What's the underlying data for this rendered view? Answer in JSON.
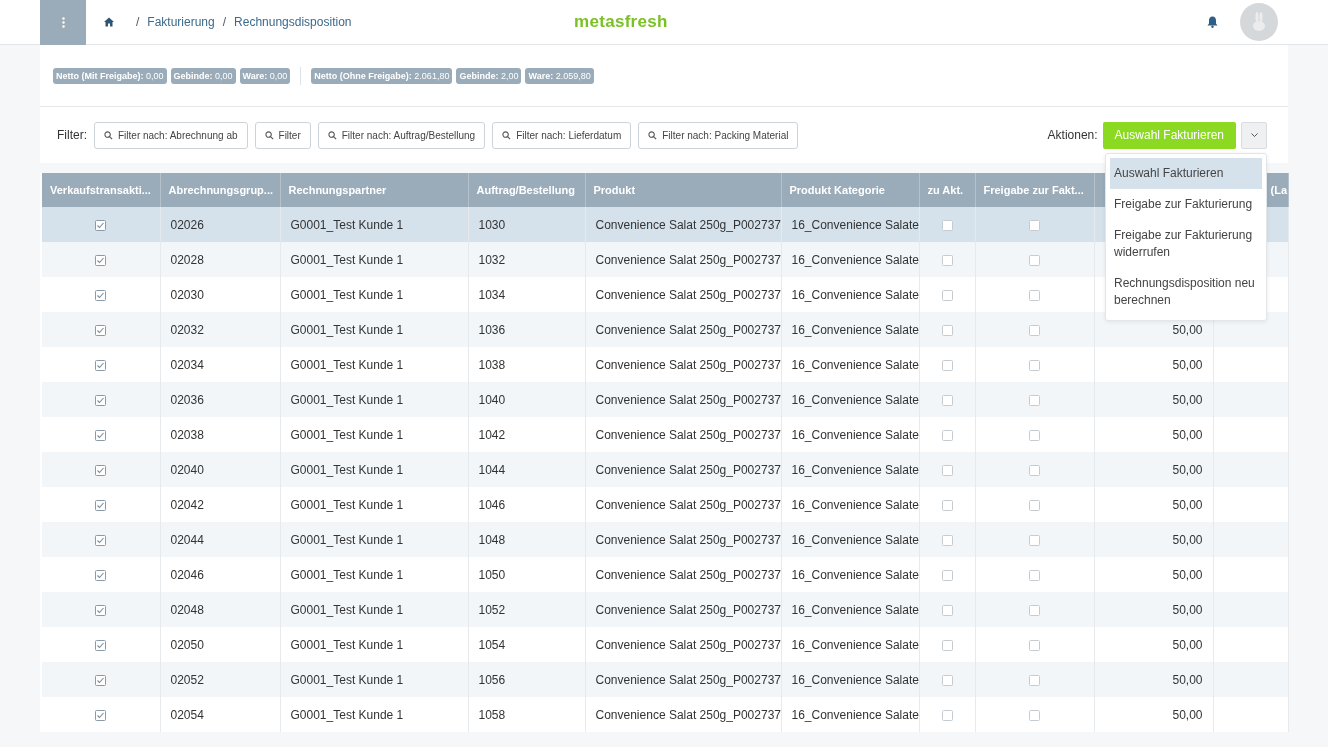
{
  "header": {
    "breadcrumb": [
      {
        "separator": "/",
        "label": "Fakturierung"
      },
      {
        "separator": "/",
        "label": "Rechnungsdisposition"
      }
    ],
    "logo": "metasfresh"
  },
  "summary": {
    "groups": [
      [
        {
          "label": "Netto (Mit Freigabe):",
          "value": "0,00"
        },
        {
          "label": "Gebinde:",
          "value": "0,00"
        },
        {
          "label": "Ware:",
          "value": "0,00"
        }
      ],
      [
        {
          "label": "Netto (Ohne Freigabe):",
          "value": "2.061,80"
        },
        {
          "label": "Gebinde:",
          "value": "2,00"
        },
        {
          "label": "Ware:",
          "value": "2.059,80"
        }
      ]
    ]
  },
  "filters": {
    "label": "Filter:",
    "items": [
      "Filter nach: Abrechnung ab",
      "Filter",
      "Filter nach: Auftrag/Bestellung",
      "Filter nach: Lieferdatum",
      "Filter nach: Packing Material"
    ]
  },
  "actions": {
    "label": "Aktionen:",
    "primary": "Auswahl Fakturieren",
    "menu": [
      {
        "label": "Auswahl Fakturieren",
        "selected": true
      },
      {
        "label": "Freigabe zur Fakturierung",
        "selected": false
      },
      {
        "label": "Freigabe zur Fakturierung widerrufen",
        "selected": false
      },
      {
        "label": "Rechnungsdisposition neu berechnen",
        "selected": false
      }
    ]
  },
  "table": {
    "columns": [
      "Verkaufstransakti...",
      "Abrechnungsgrup...",
      "Rechnungspartner",
      "Auftrag/Bestellung",
      "Produkt",
      "Produkt Kategorie",
      "zu Akt.",
      "Freigabe zur Fakt...",
      null,
      "(La"
    ],
    "rows": [
      {
        "selected": true,
        "sales": true,
        "group": "02026",
        "partner": "G0001_Test Kunde 1",
        "order": "1030",
        "product": "Convenience Salat 250g_P002737",
        "category": "16_Convenience Salate",
        "update": false,
        "release": false
      },
      {
        "selected": false,
        "sales": true,
        "group": "02028",
        "partner": "G0001_Test Kunde 1",
        "order": "1032",
        "product": "Convenience Salat 250g_P002737",
        "category": "16_Convenience Salate",
        "update": false,
        "release": false
      },
      {
        "selected": false,
        "sales": true,
        "group": "02030",
        "partner": "G0001_Test Kunde 1",
        "order": "1034",
        "product": "Convenience Salat 250g_P002737",
        "category": "16_Convenience Salate",
        "update": false,
        "release": false
      },
      {
        "selected": false,
        "sales": true,
        "group": "02032",
        "partner": "G0001_Test Kunde 1",
        "order": "1036",
        "product": "Convenience Salat 250g_P002737",
        "category": "16_Convenience Salate",
        "update": false,
        "release": false,
        "amount": "50,00"
      },
      {
        "selected": false,
        "sales": true,
        "group": "02034",
        "partner": "G0001_Test Kunde 1",
        "order": "1038",
        "product": "Convenience Salat 250g_P002737",
        "category": "16_Convenience Salate",
        "update": false,
        "release": false,
        "amount": "50,00"
      },
      {
        "selected": false,
        "sales": true,
        "group": "02036",
        "partner": "G0001_Test Kunde 1",
        "order": "1040",
        "product": "Convenience Salat 250g_P002737",
        "category": "16_Convenience Salate",
        "update": false,
        "release": false,
        "amount": "50,00"
      },
      {
        "selected": false,
        "sales": true,
        "group": "02038",
        "partner": "G0001_Test Kunde 1",
        "order": "1042",
        "product": "Convenience Salat 250g_P002737",
        "category": "16_Convenience Salate",
        "update": false,
        "release": false,
        "amount": "50,00"
      },
      {
        "selected": false,
        "sales": true,
        "group": "02040",
        "partner": "G0001_Test Kunde 1",
        "order": "1044",
        "product": "Convenience Salat 250g_P002737",
        "category": "16_Convenience Salate",
        "update": false,
        "release": false,
        "amount": "50,00"
      },
      {
        "selected": false,
        "sales": true,
        "group": "02042",
        "partner": "G0001_Test Kunde 1",
        "order": "1046",
        "product": "Convenience Salat 250g_P002737",
        "category": "16_Convenience Salate",
        "update": false,
        "release": false,
        "amount": "50,00"
      },
      {
        "selected": false,
        "sales": true,
        "group": "02044",
        "partner": "G0001_Test Kunde 1",
        "order": "1048",
        "product": "Convenience Salat 250g_P002737",
        "category": "16_Convenience Salate",
        "update": false,
        "release": false,
        "amount": "50,00"
      },
      {
        "selected": false,
        "sales": true,
        "group": "02046",
        "partner": "G0001_Test Kunde 1",
        "order": "1050",
        "product": "Convenience Salat 250g_P002737",
        "category": "16_Convenience Salate",
        "update": false,
        "release": false,
        "amount": "50,00"
      },
      {
        "selected": false,
        "sales": true,
        "group": "02048",
        "partner": "G0001_Test Kunde 1",
        "order": "1052",
        "product": "Convenience Salat 250g_P002737",
        "category": "16_Convenience Salate",
        "update": false,
        "release": false,
        "amount": "50,00"
      },
      {
        "selected": false,
        "sales": true,
        "group": "02050",
        "partner": "G0001_Test Kunde 1",
        "order": "1054",
        "product": "Convenience Salat 250g_P002737",
        "category": "16_Convenience Salate",
        "update": false,
        "release": false,
        "amount": "50,00"
      },
      {
        "selected": false,
        "sales": true,
        "group": "02052",
        "partner": "G0001_Test Kunde 1",
        "order": "1056",
        "product": "Convenience Salat 250g_P002737",
        "category": "16_Convenience Salate",
        "update": false,
        "release": false,
        "amount": "50,00"
      },
      {
        "selected": false,
        "sales": true,
        "group": "02054",
        "partner": "G0001_Test Kunde 1",
        "order": "1058",
        "product": "Convenience Salat 250g_P002737",
        "category": "16_Convenience Salate",
        "update": false,
        "release": false,
        "amount": "50,00"
      }
    ]
  }
}
